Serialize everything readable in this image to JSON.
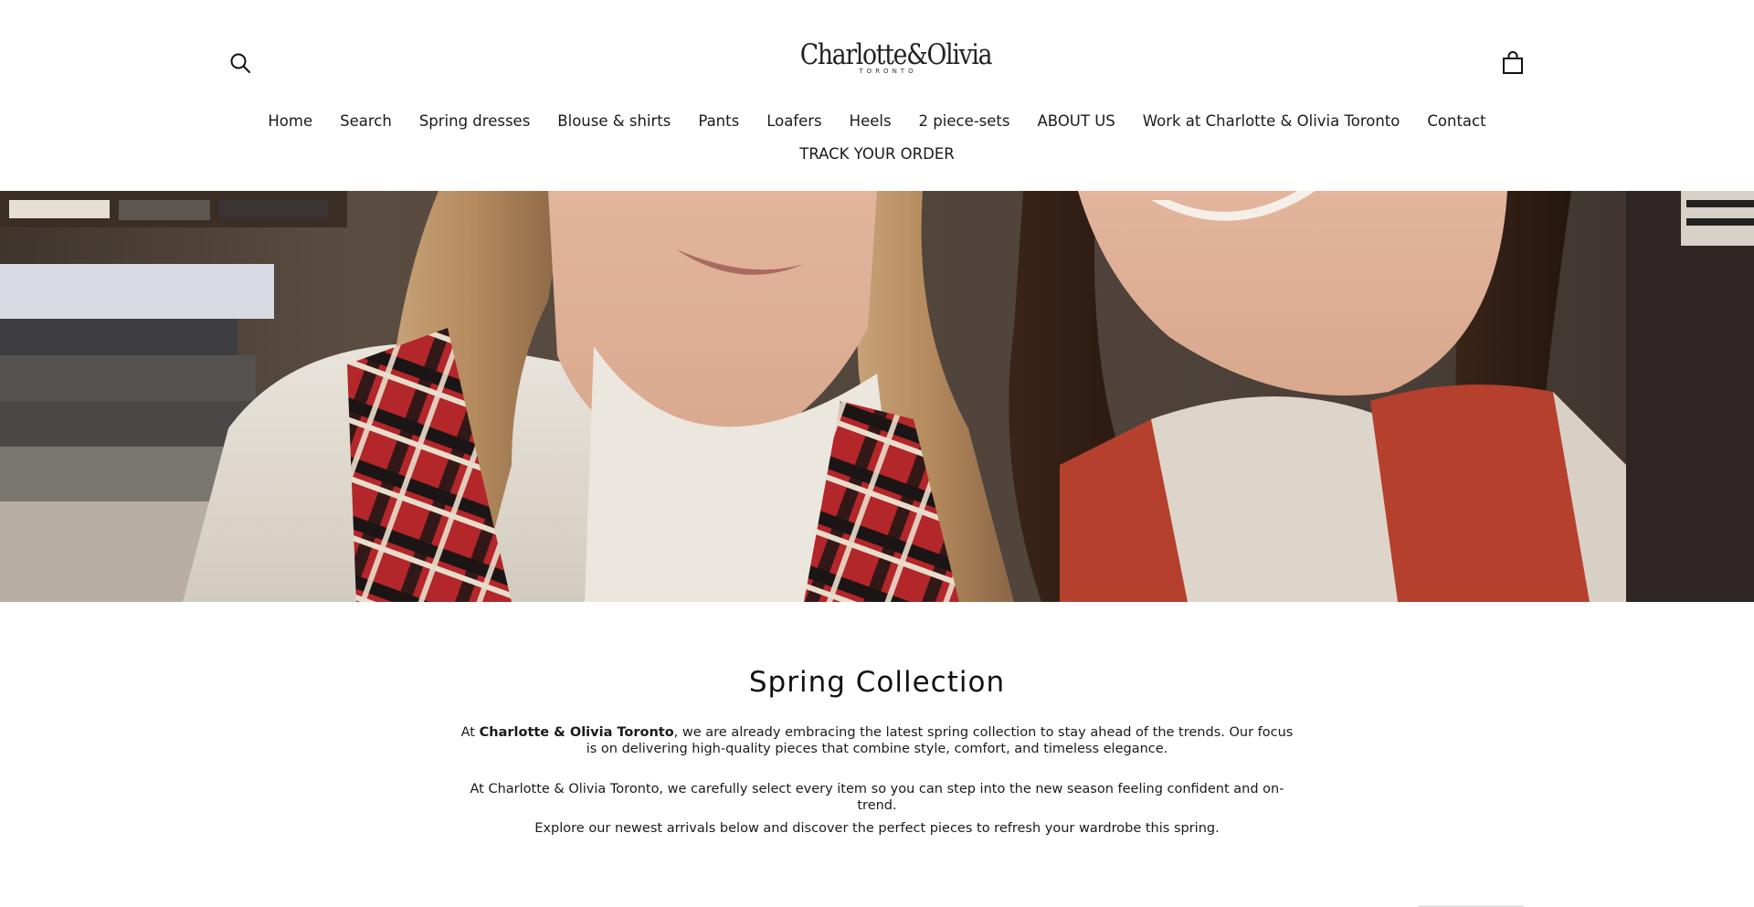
{
  "header": {
    "logo_text": "Charlotte&Olivia",
    "logo_subtext": "TORONTO"
  },
  "nav": {
    "row1": [
      "Home",
      "Search",
      "Spring dresses",
      "Blouse & shirts",
      "Pants",
      "Loafers",
      "Heels",
      "2 piece-sets",
      "ABOUT US",
      "Work at Charlotte & Olivia Toronto",
      "Contact"
    ],
    "row2": [
      "TRACK YOUR ORDER"
    ]
  },
  "icons": {
    "search": "search-icon",
    "cart": "shopping-bag-icon"
  },
  "collection": {
    "title": "Spring Collection",
    "p1_pre": "At ",
    "p1_bold": "Charlotte & Olivia Toronto",
    "p1_post": ", we are already embracing the latest spring collection to stay ahead of the trends. Our focus is on delivering high-quality pieces that combine style, comfort, and timeless elegance.",
    "p2": "At Charlotte & Olivia Toronto, we carefully select every item so you can step into the new season feeling confident and on-trend.",
    "p3": "Explore our newest arrivals below and discover the perfect pieces to refresh your wardrobe this spring."
  },
  "colors": {
    "text": "#1a1a1a",
    "background": "#ffffff",
    "scarf_red": "#b3262a",
    "vest_red": "#b5402e"
  }
}
